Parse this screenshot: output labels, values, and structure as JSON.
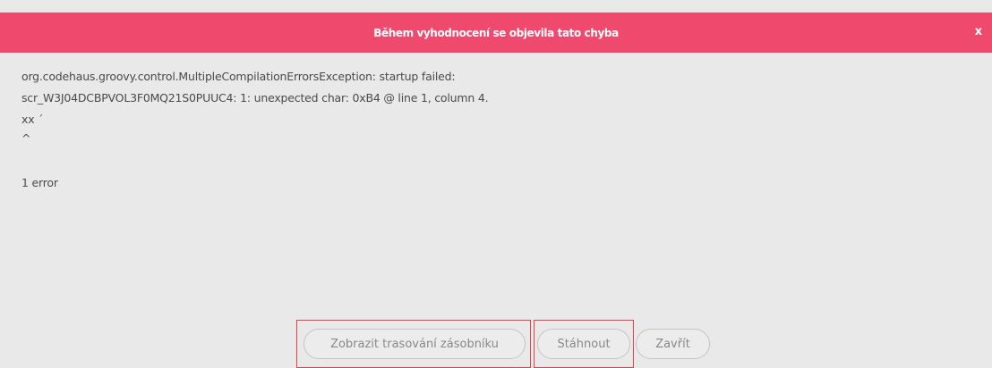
{
  "dialog": {
    "title": "Během vyhodnocení se objevila tato chyba",
    "close_label": "x",
    "error_lines": [
      "org.codehaus.groovy.control.MultipleCompilationErrorsException: startup failed:",
      "scr_W3J04DCBPVOL3F0MQ21S0PUUC4: 1: unexpected char: 0xB4 @ line 1, column 4.",
      "xx ´",
      "^",
      "",
      "1 error"
    ]
  },
  "footer": {
    "stack_trace_label": "Zobrazit trasování zásobníku",
    "download_label": "Stáhnout",
    "close_label": "Zavřít"
  },
  "colors": {
    "titlebar": "#ef4a6e",
    "background": "#e9e9e9",
    "highlight": "#e0404a"
  }
}
